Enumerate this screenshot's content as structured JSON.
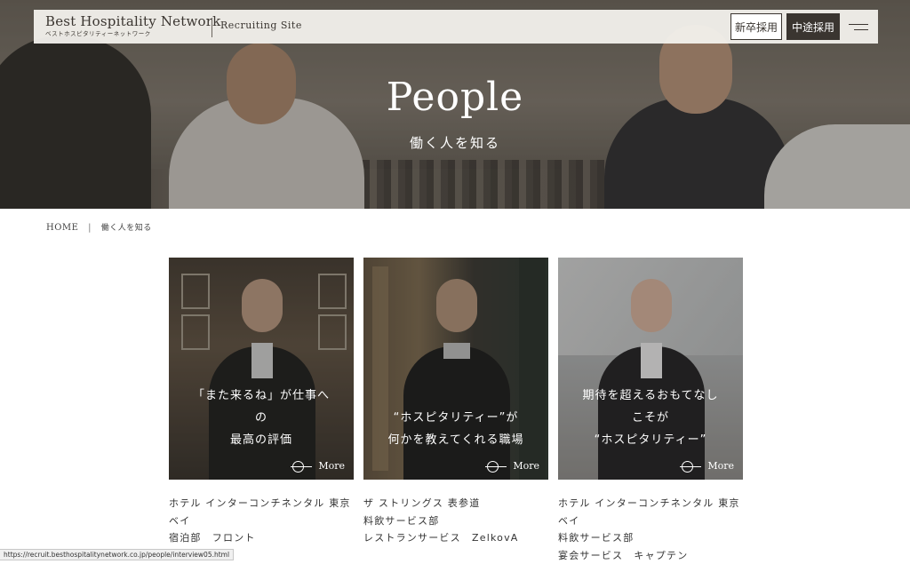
{
  "header": {
    "logo_main": "Best Hospitality Network",
    "logo_sub": "ベストホスピタリティーネットワーク",
    "site_label": "Recruiting Site",
    "new_grad_button": "新卒採用",
    "mid_career_button": "中途採用"
  },
  "hero": {
    "title": "People",
    "subtitle": "働く人を知る"
  },
  "breadcrumb": {
    "home": "HOME",
    "separator": "|",
    "current": "働く人を知る"
  },
  "cards": [
    {
      "catch_lines": [
        "「また来るね」が仕事へ",
        "の",
        "最高の評価"
      ],
      "more_label": "More",
      "info": [
        "ホテル インターコンチネンタル 東京ベイ",
        "宿泊部　フロント"
      ]
    },
    {
      "catch_lines": [
        "“ホスピタリティー”が",
        "何かを教えてくれる職場"
      ],
      "more_label": "More",
      "info": [
        "ザ ストリングス 表参道",
        "料飲サービス部",
        "レストランサービス　ZelkovA"
      ]
    },
    {
      "catch_lines": [
        "期待を超えるおもてなし",
        "こそが",
        "“ホスピタリティー”"
      ],
      "more_label": "More",
      "info": [
        "ホテル インターコンチネンタル 東京ベイ",
        "料飲サービス部",
        "宴会サービス　キャプテン"
      ]
    }
  ],
  "status_bar": {
    "url": "https://recruit.besthospitalitynetwork.co.jp/people/interview05.html"
  }
}
